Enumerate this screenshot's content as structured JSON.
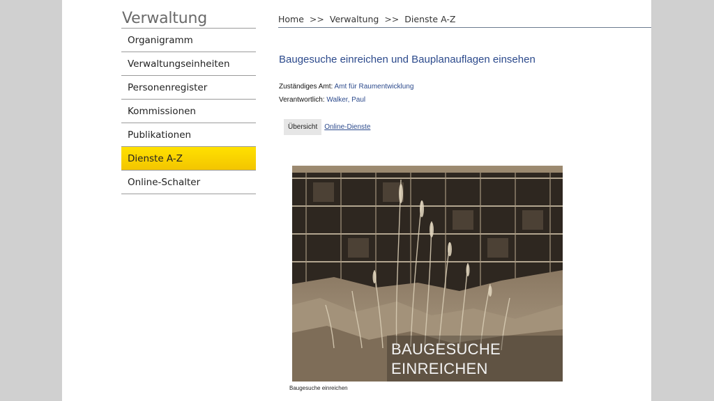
{
  "header": {
    "section_title": "Verwaltung",
    "breadcrumb": [
      "Home",
      "Verwaltung",
      "Dienste A-Z"
    ],
    "breadcrumb_separator": ">>"
  },
  "sidebar": {
    "items": [
      {
        "label": "Organigramm",
        "active": false
      },
      {
        "label": "Verwaltungseinheiten",
        "active": false
      },
      {
        "label": "Personenregister",
        "active": false
      },
      {
        "label": "Kommissionen",
        "active": false
      },
      {
        "label": "Publikationen",
        "active": false
      },
      {
        "label": "Dienste A-Z",
        "active": true
      },
      {
        "label": "Online-Schalter",
        "active": false
      }
    ]
  },
  "main": {
    "heading": "Baugesuche einreichen und Bauplanauflagen einsehen",
    "office_label": "Zuständiges Amt:",
    "office_link": "Amt für Raumentwicklung",
    "responsible_label": "Verantwortlich:",
    "responsible_link": "Walker, Paul",
    "tabs": [
      {
        "label": "Übersicht",
        "active": true
      },
      {
        "label": "Online-Dienste",
        "active": false
      }
    ],
    "image": {
      "overlay_line1": "BAUGESUCHE",
      "overlay_line2": "EINREICHEN",
      "caption": "Baugesuche einreichen"
    }
  },
  "colors": {
    "accent_yellow": "#f7d200",
    "link_blue": "#2c4a8c",
    "page_bg": "#d0d0d0"
  }
}
